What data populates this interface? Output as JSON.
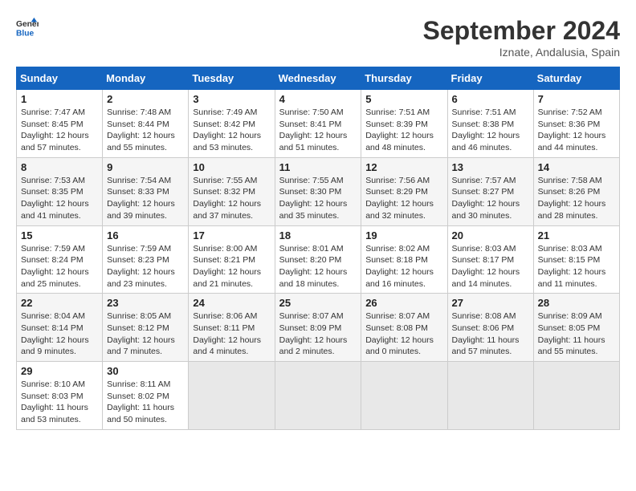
{
  "header": {
    "logo_general": "General",
    "logo_blue": "Blue",
    "month": "September 2024",
    "location": "Iznate, Andalusia, Spain"
  },
  "columns": [
    "Sunday",
    "Monday",
    "Tuesday",
    "Wednesday",
    "Thursday",
    "Friday",
    "Saturday"
  ],
  "weeks": [
    [
      {
        "day": "1",
        "info": "Sunrise: 7:47 AM\nSunset: 8:45 PM\nDaylight: 12 hours\nand 57 minutes."
      },
      {
        "day": "2",
        "info": "Sunrise: 7:48 AM\nSunset: 8:44 PM\nDaylight: 12 hours\nand 55 minutes."
      },
      {
        "day": "3",
        "info": "Sunrise: 7:49 AM\nSunset: 8:42 PM\nDaylight: 12 hours\nand 53 minutes."
      },
      {
        "day": "4",
        "info": "Sunrise: 7:50 AM\nSunset: 8:41 PM\nDaylight: 12 hours\nand 51 minutes."
      },
      {
        "day": "5",
        "info": "Sunrise: 7:51 AM\nSunset: 8:39 PM\nDaylight: 12 hours\nand 48 minutes."
      },
      {
        "day": "6",
        "info": "Sunrise: 7:51 AM\nSunset: 8:38 PM\nDaylight: 12 hours\nand 46 minutes."
      },
      {
        "day": "7",
        "info": "Sunrise: 7:52 AM\nSunset: 8:36 PM\nDaylight: 12 hours\nand 44 minutes."
      }
    ],
    [
      {
        "day": "8",
        "info": "Sunrise: 7:53 AM\nSunset: 8:35 PM\nDaylight: 12 hours\nand 41 minutes."
      },
      {
        "day": "9",
        "info": "Sunrise: 7:54 AM\nSunset: 8:33 PM\nDaylight: 12 hours\nand 39 minutes."
      },
      {
        "day": "10",
        "info": "Sunrise: 7:55 AM\nSunset: 8:32 PM\nDaylight: 12 hours\nand 37 minutes."
      },
      {
        "day": "11",
        "info": "Sunrise: 7:55 AM\nSunset: 8:30 PM\nDaylight: 12 hours\nand 35 minutes."
      },
      {
        "day": "12",
        "info": "Sunrise: 7:56 AM\nSunset: 8:29 PM\nDaylight: 12 hours\nand 32 minutes."
      },
      {
        "day": "13",
        "info": "Sunrise: 7:57 AM\nSunset: 8:27 PM\nDaylight: 12 hours\nand 30 minutes."
      },
      {
        "day": "14",
        "info": "Sunrise: 7:58 AM\nSunset: 8:26 PM\nDaylight: 12 hours\nand 28 minutes."
      }
    ],
    [
      {
        "day": "15",
        "info": "Sunrise: 7:59 AM\nSunset: 8:24 PM\nDaylight: 12 hours\nand 25 minutes."
      },
      {
        "day": "16",
        "info": "Sunrise: 7:59 AM\nSunset: 8:23 PM\nDaylight: 12 hours\nand 23 minutes."
      },
      {
        "day": "17",
        "info": "Sunrise: 8:00 AM\nSunset: 8:21 PM\nDaylight: 12 hours\nand 21 minutes."
      },
      {
        "day": "18",
        "info": "Sunrise: 8:01 AM\nSunset: 8:20 PM\nDaylight: 12 hours\nand 18 minutes."
      },
      {
        "day": "19",
        "info": "Sunrise: 8:02 AM\nSunset: 8:18 PM\nDaylight: 12 hours\nand 16 minutes."
      },
      {
        "day": "20",
        "info": "Sunrise: 8:03 AM\nSunset: 8:17 PM\nDaylight: 12 hours\nand 14 minutes."
      },
      {
        "day": "21",
        "info": "Sunrise: 8:03 AM\nSunset: 8:15 PM\nDaylight: 12 hours\nand 11 minutes."
      }
    ],
    [
      {
        "day": "22",
        "info": "Sunrise: 8:04 AM\nSunset: 8:14 PM\nDaylight: 12 hours\nand 9 minutes."
      },
      {
        "day": "23",
        "info": "Sunrise: 8:05 AM\nSunset: 8:12 PM\nDaylight: 12 hours\nand 7 minutes."
      },
      {
        "day": "24",
        "info": "Sunrise: 8:06 AM\nSunset: 8:11 PM\nDaylight: 12 hours\nand 4 minutes."
      },
      {
        "day": "25",
        "info": "Sunrise: 8:07 AM\nSunset: 8:09 PM\nDaylight: 12 hours\nand 2 minutes."
      },
      {
        "day": "26",
        "info": "Sunrise: 8:07 AM\nSunset: 8:08 PM\nDaylight: 12 hours\nand 0 minutes."
      },
      {
        "day": "27",
        "info": "Sunrise: 8:08 AM\nSunset: 8:06 PM\nDaylight: 11 hours\nand 57 minutes."
      },
      {
        "day": "28",
        "info": "Sunrise: 8:09 AM\nSunset: 8:05 PM\nDaylight: 11 hours\nand 55 minutes."
      }
    ],
    [
      {
        "day": "29",
        "info": "Sunrise: 8:10 AM\nSunset: 8:03 PM\nDaylight: 11 hours\nand 53 minutes."
      },
      {
        "day": "30",
        "info": "Sunrise: 8:11 AM\nSunset: 8:02 PM\nDaylight: 11 hours\nand 50 minutes."
      },
      {
        "day": "",
        "info": ""
      },
      {
        "day": "",
        "info": ""
      },
      {
        "day": "",
        "info": ""
      },
      {
        "day": "",
        "info": ""
      },
      {
        "day": "",
        "info": ""
      }
    ]
  ]
}
